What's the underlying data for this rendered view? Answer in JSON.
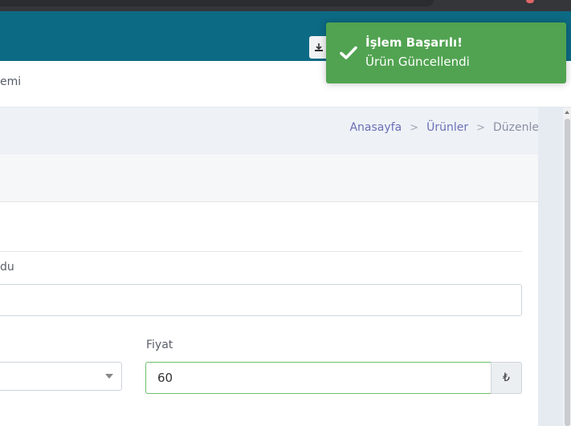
{
  "menu": {
    "partial_label": "emi"
  },
  "breadcrumb": {
    "items": [
      "Anasayfa",
      "Ürünler",
      "Düzenle"
    ],
    "separator": ">"
  },
  "form": {
    "partial_field_label": "du",
    "price_label": "Fiyat",
    "price_value": "60",
    "currency_symbol": "₺"
  },
  "toast": {
    "title": "İşlem Başarılı!",
    "message": "Ürün Güncellendi",
    "color": "#51a351"
  },
  "colors": {
    "topbar": "#0d6a85",
    "breadcrumb_link": "#6b6fb6"
  },
  "icons": {
    "toast": "check-icon",
    "download": "download-icon",
    "select": "caret-down-icon"
  }
}
